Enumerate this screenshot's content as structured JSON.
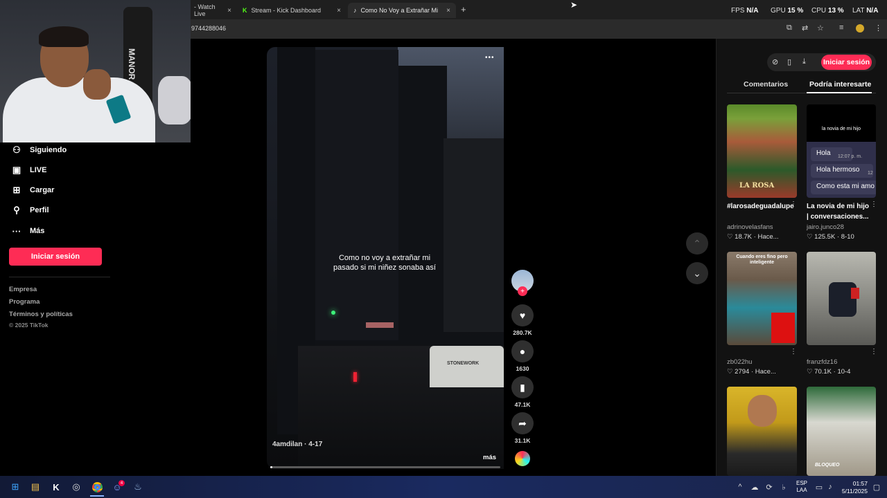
{
  "browser": {
    "tabs": [
      {
        "label": "- Watch Live",
        "close": "×"
      },
      {
        "label": "Stream - Kick Dashboard",
        "close": "×"
      },
      {
        "label": "Como No Voy a Extrañar Mi Ni...",
        "close": "×"
      }
    ],
    "new_tab": "+",
    "url": "9744288046",
    "stats": [
      {
        "label": "FPS",
        "value": "N/A"
      },
      {
        "label": "GPU",
        "value": "15 %"
      },
      {
        "label": "CPU",
        "value": "13 %"
      },
      {
        "label": "LAT",
        "value": "N/A"
      }
    ]
  },
  "sidebar": {
    "items": [
      {
        "label": "Siguiendo",
        "icon": "following-icon"
      },
      {
        "label": "LIVE",
        "icon": "live-icon"
      },
      {
        "label": "Cargar",
        "icon": "upload-icon"
      },
      {
        "label": "Perfil",
        "icon": "profile-icon"
      },
      {
        "label": "Más",
        "icon": "more-icon"
      }
    ],
    "login_button": "Iniciar sesión",
    "footer_links": [
      "Empresa",
      "Programa",
      "Términos y políticas"
    ],
    "copyright": "© 2025 TikTok"
  },
  "video": {
    "caption": "Como no voy a extrañar mi pasado si mi niñez sonaba así",
    "author_line": "4amdilan · 4-17",
    "more_label": "más",
    "menu_dots": "•••",
    "sign_text": "STONEWORK",
    "progress": 0.01
  },
  "actions": {
    "likes": "280.7K",
    "comments": "1630",
    "saves": "47.1K",
    "shares": "31.1K"
  },
  "right_panel": {
    "header_button": "Iniciar sesión",
    "tabs": [
      "Comentarios",
      "Podría interesarte"
    ],
    "active_tab": 1,
    "videos": [
      {
        "title": "#larosadeguadalupe",
        "user": "adrinovelasfans",
        "likes": "18.7K",
        "date": "Hace...",
        "thumb_text": "LA ROSA"
      },
      {
        "title": "La novia de mi hijo | conversaciones...",
        "user": "jairo.junco28",
        "likes": "125.5K",
        "date": "8-10",
        "thumb_text": "la novia de mi hijo",
        "chat": [
          {
            "text": "Hola",
            "time": "12:07 p. m."
          },
          {
            "text": "Hola hermoso",
            "time": "12"
          },
          {
            "text": "Como esta mi amo",
            "time": ""
          }
        ]
      },
      {
        "title": "",
        "user": "zb022hu",
        "likes": "2794",
        "date": "Hace...",
        "thumb_text": "Cuando eres fino pero inteligente"
      },
      {
        "title": "",
        "user": "franzfdz16",
        "likes": "70.1K",
        "date": "10-4",
        "thumb_text": ""
      },
      {
        "title": "",
        "user": "",
        "likes": "",
        "date": "",
        "thumb_text": ""
      },
      {
        "title": "",
        "user": "",
        "likes": "",
        "date": "",
        "thumb_text": "BLOQUEO"
      }
    ]
  },
  "webcam": {
    "bag_text": "MANOR"
  },
  "taskbar": {
    "lang": "ESP",
    "lang2": "LAA",
    "time": "01:57",
    "date": "5/11/2025",
    "discord_badge": "4"
  }
}
